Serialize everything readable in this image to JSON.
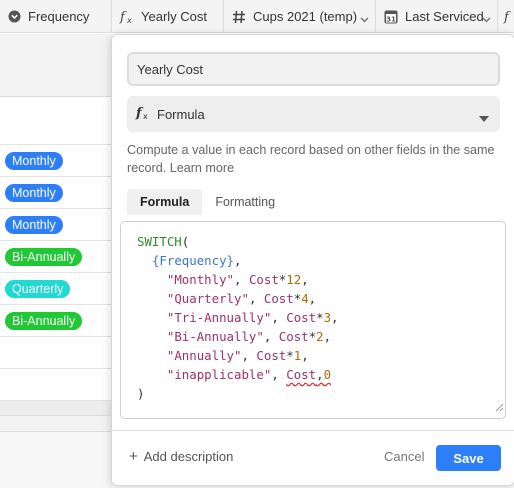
{
  "header": {
    "columns": [
      {
        "label": "Frequency",
        "icon": "single-select-icon"
      },
      {
        "label": "Yearly Cost",
        "icon": "formula-icon"
      },
      {
        "label": "Cups 2021 (temp)",
        "icon": "number-icon"
      },
      {
        "label": "Last Serviced",
        "icon": "calendar-icon",
        "calendar_day": "31"
      },
      {
        "label": "",
        "icon": "formula-icon"
      }
    ]
  },
  "frequency_values": [
    {
      "label": "Monthly",
      "color": "#2d7ff9"
    },
    {
      "label": "Monthly",
      "color": "#2d7ff9"
    },
    {
      "label": "Monthly",
      "color": "#2d7ff9"
    },
    {
      "label": "Bi-Annually",
      "color": "#20c933"
    },
    {
      "label": "Quarterly",
      "color": "#20d9d2"
    },
    {
      "label": "Bi-Annually",
      "color": "#20c933"
    }
  ],
  "dialog": {
    "field_name": "Yearly Cost",
    "field_type": "Formula",
    "description": "Compute a value in each record based on other fields in the same record.",
    "learn_more": "Learn more",
    "tabs": [
      {
        "label": "Formula",
        "active": true
      },
      {
        "label": "Formatting",
        "active": false
      }
    ],
    "formula_lines": [
      "SWITCH(",
      "  {Frequency},",
      "    \"Monthly\", Cost*12,",
      "    \"Quarterly\", Cost*4,",
      "    \"Tri-Annually\", Cost*3,",
      "    \"Bi-Annually\", Cost*2,",
      "    \"Annually\", Cost*1,",
      "    \"inapplicable\", Cost,0",
      ")"
    ],
    "add_description": "Add description",
    "cancel_label": "Cancel",
    "save_label": "Save"
  },
  "colors": {
    "accent": "#2d7ff9",
    "monthly": "#2d7ff9",
    "bi_annually": "#20c933",
    "quarterly": "#20d9d2"
  }
}
